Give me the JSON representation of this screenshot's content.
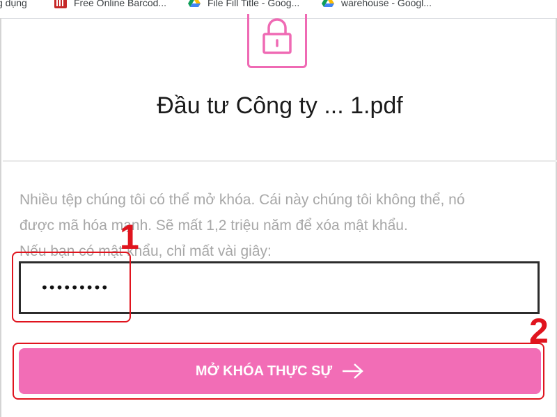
{
  "bookmarks": [
    {
      "label": "g dụng",
      "icon": "apps-icon"
    },
    {
      "label": "Free Online Barcod...",
      "icon": "barcode-icon"
    },
    {
      "label": "File Fill Title - Goog...",
      "icon": "google-drive-icon"
    },
    {
      "label": "warehouse - Googl...",
      "icon": "google-drive-icon"
    }
  ],
  "file": {
    "title": "Đầu tư Công ty ... 1.pdf",
    "icon": "lock-icon"
  },
  "description": {
    "line1": "Nhiều tệp chúng tôi có thể mở khóa. Cái này chúng tôi không thể, nó",
    "line2": "được mã hóa mạnh. Sẽ mất 1,2 triệu năm để xóa mật khẩu.",
    "line3": "Nếu bạn có mật khẩu, chỉ mất vài giây:"
  },
  "password": {
    "value": "•••••••••"
  },
  "unlock_button": {
    "label": "MỞ KHÓA THỰC SỰ",
    "icon": "arrow-right-icon"
  },
  "annotations": {
    "step1": "1",
    "step2": "2"
  },
  "colors": {
    "accent": "#f26db6",
    "highlight": "#e0141e"
  }
}
